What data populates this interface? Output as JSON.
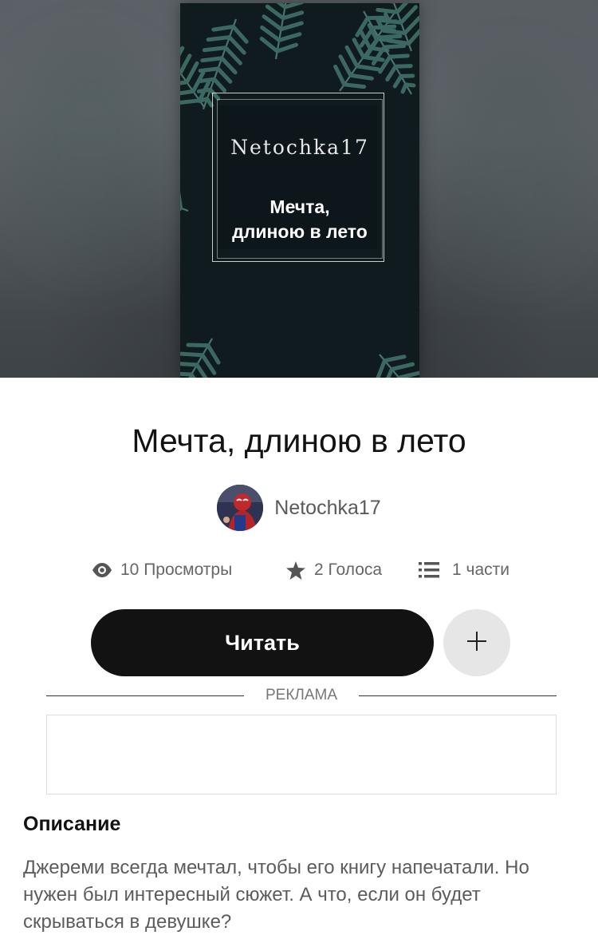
{
  "cover": {
    "author": "Netochka17",
    "title_line1": "Мечта,",
    "title_line2": "длиною в лето"
  },
  "story": {
    "title": "Мечта, длиною в лето",
    "author": "Netochka17"
  },
  "stats": {
    "views": "10 Просмотры",
    "votes": "2 Голоса",
    "parts": "1 части"
  },
  "actions": {
    "read_label": "Читать",
    "add_label": "+"
  },
  "ad": {
    "label": "РЕКЛАМА"
  },
  "description": {
    "heading": "Описание",
    "text": "Джереми всегда мечтал, чтобы его книгу напечатали. Но нужен был интересный сюжет. А что, если он будет скрываться в девушке?"
  },
  "colors": {
    "primary_button": "#121212",
    "secondary_button": "#e6e6e6",
    "text_muted": "#666666"
  },
  "icons": {
    "views": "eye-icon",
    "votes": "star-icon",
    "parts": "list-icon",
    "add": "plus-icon"
  }
}
